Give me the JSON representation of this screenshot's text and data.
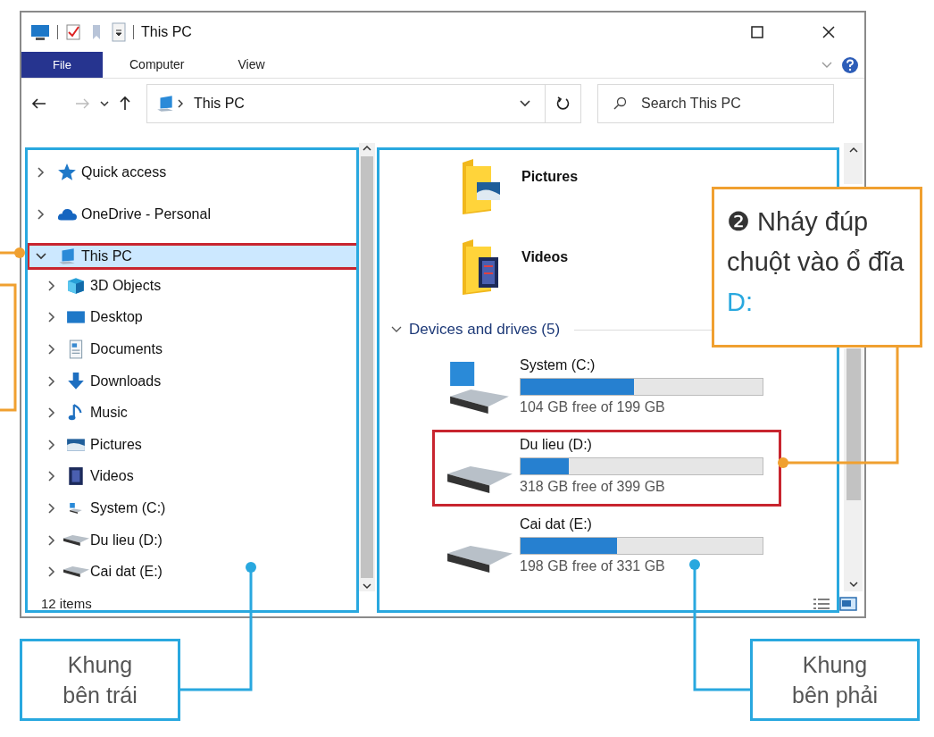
{
  "window": {
    "title": "This PC"
  },
  "ribbon": {
    "tabs": [
      {
        "label": "File",
        "selected": true
      },
      {
        "label": "Computer",
        "selected": false
      },
      {
        "label": "View",
        "selected": false
      }
    ]
  },
  "address_bar": {
    "path": [
      "This PC"
    ],
    "search": {
      "placeholder": "Search This PC"
    }
  },
  "navigation_pane": {
    "items": [
      {
        "label": "Quick access",
        "kind": "star",
        "expanded": false,
        "selected": false,
        "highlighted": false
      },
      {
        "label": "OneDrive - Personal",
        "kind": "cloud",
        "expanded": false,
        "selected": false,
        "highlighted": false
      },
      {
        "label": "This PC",
        "kind": "pc",
        "expanded": true,
        "selected": true,
        "highlighted": true,
        "children": [
          {
            "label": "3D Objects",
            "kind": "cube",
            "expanded": false,
            "selected": false,
            "highlighted": false
          },
          {
            "label": "Desktop",
            "kind": "desktop",
            "expanded": false,
            "selected": false,
            "highlighted": false
          },
          {
            "label": "Documents",
            "kind": "document",
            "expanded": false,
            "selected": false,
            "highlighted": false
          },
          {
            "label": "Downloads",
            "kind": "download",
            "expanded": false,
            "selected": false,
            "highlighted": false
          },
          {
            "label": "Music",
            "kind": "music",
            "expanded": false,
            "selected": false,
            "highlighted": false
          },
          {
            "label": "Pictures",
            "kind": "pictures",
            "expanded": false,
            "selected": false,
            "highlighted": false
          },
          {
            "label": "Videos",
            "kind": "videos",
            "expanded": false,
            "selected": false,
            "highlighted": false
          },
          {
            "label": "System (C:)",
            "kind": "system-drive",
            "expanded": false,
            "selected": false,
            "highlighted": false
          },
          {
            "label": "Du lieu (D:)",
            "kind": "drive",
            "expanded": false,
            "selected": false,
            "highlighted": false
          },
          {
            "label": "Cai dat (E:)",
            "kind": "drive",
            "expanded": false,
            "selected": false,
            "highlighted": false
          }
        ]
      }
    ]
  },
  "content_pane": {
    "folders": [
      {
        "name": "Pictures",
        "kind": "pictures"
      },
      {
        "name": "Videos",
        "kind": "videos"
      }
    ],
    "groups": [
      {
        "title": "Devices and drives (5)",
        "expanded": true,
        "drives": [
          {
            "name": "System (C:)",
            "kind": "system-drive",
            "level": 0.47,
            "reading": "104 GB free of 199 GB",
            "highlighted": false
          },
          {
            "name": "Du lieu (D:)",
            "kind": "drive",
            "level": 0.2,
            "reading": "318 GB free of 399 GB",
            "highlighted": true
          },
          {
            "name": "Cai dat (E:)",
            "kind": "drive",
            "level": 0.4,
            "reading": "198 GB free of 331 GB",
            "highlighted": false
          }
        ]
      }
    ]
  },
  "status_bar": {
    "text": "12 items"
  },
  "annotations": {
    "instruction": {
      "marker": "❷",
      "text": "Nháy đúp chuột vào ổ đĩa",
      "target": "D:"
    },
    "labels": [
      "Khung bên trái",
      "Khung bên phải"
    ]
  }
}
